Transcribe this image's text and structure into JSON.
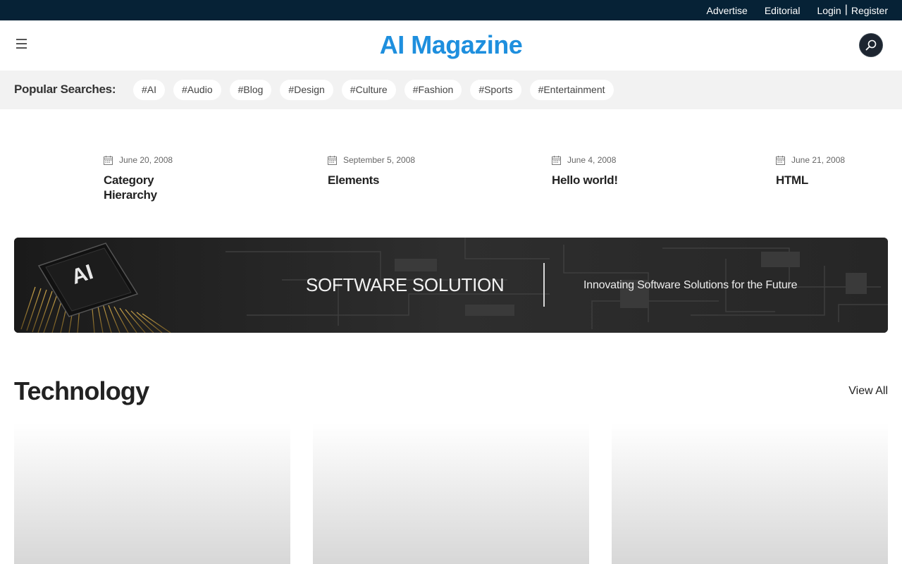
{
  "topbar": {
    "advertise": "Advertise",
    "editorial": "Editorial",
    "login": "Login",
    "separator": "|",
    "register": "Register"
  },
  "header": {
    "logo": "AI Magazine"
  },
  "popular": {
    "title": "Popular Searches:",
    "tags": [
      "#AI",
      "#Audio",
      "#Blog",
      "#Design",
      "#Culture",
      "#Fashion",
      "#Sports",
      "#Entertainment"
    ]
  },
  "posts": [
    {
      "date": "June 20, 2008",
      "title": "Category Hierarchy"
    },
    {
      "date": "September 5, 2008",
      "title": "Elements"
    },
    {
      "date": "June 4, 2008",
      "title": "Hello world!"
    },
    {
      "date": "June 21, 2008",
      "title": "HTML"
    }
  ],
  "banner": {
    "chip_text": "AI",
    "headline": "SOFTWARE SOLUTION",
    "tagline": "Innovating Software Solutions for the Future"
  },
  "technology": {
    "title": "Technology",
    "view_all": "View All"
  },
  "colors": {
    "topbar": "#062236",
    "logo": "#1e8fde",
    "popular_bg": "#f2f2f2"
  }
}
